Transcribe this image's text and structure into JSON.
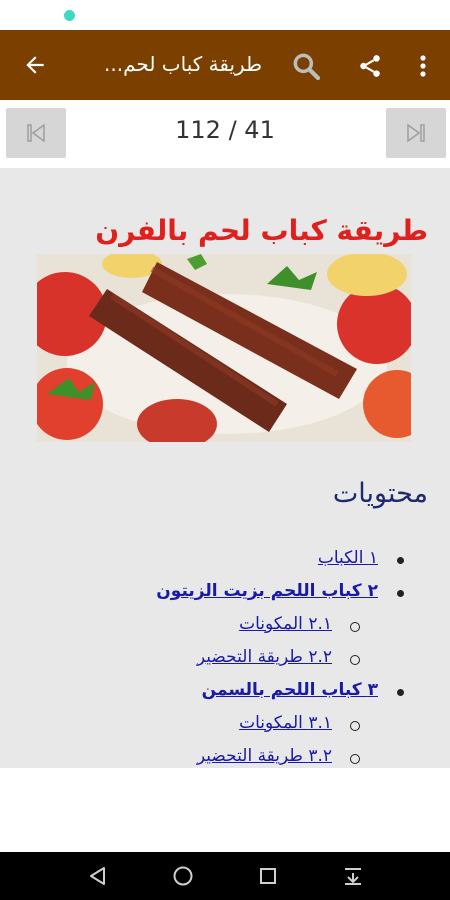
{
  "app_bar": {
    "title": "طريقة كباب لحم...",
    "back_icon": "arrow-left-icon",
    "search_icon": "search-icon",
    "share_icon": "share-icon",
    "menu_icon": "more-vert-icon",
    "color": "#7b3f00"
  },
  "pager": {
    "counter": "112 / 41",
    "first_icon": "skip-first-icon",
    "last_icon": "skip-last-icon"
  },
  "article": {
    "title": "طريقة كباب لحم بالفرن",
    "title_color": "#e0201c",
    "image_alt": "kebab-image"
  },
  "toc": {
    "heading": "محتويات",
    "items": [
      {
        "label": "١ الكباب",
        "level": 1,
        "bold": false
      },
      {
        "label": "٢ كباب اللحم بزيت الزيتون",
        "level": 1,
        "bold": true
      },
      {
        "label": "٢.١ المكونات",
        "level": 2,
        "bold": false
      },
      {
        "label": "٢.٢ طريقة التحضير",
        "level": 2,
        "bold": false
      },
      {
        "label": "٣ كباب اللحم بالسمن",
        "level": 1,
        "bold": true
      },
      {
        "label": "٣.١ المكونات",
        "level": 2,
        "bold": false
      },
      {
        "label": "٣.٢ طريقة التحضير",
        "level": 2,
        "bold": false
      }
    ]
  },
  "nav_bar": {
    "back_icon": "nav-back-icon",
    "home_icon": "nav-home-icon",
    "recents_icon": "nav-recents-icon",
    "download_icon": "nav-download-icon"
  }
}
